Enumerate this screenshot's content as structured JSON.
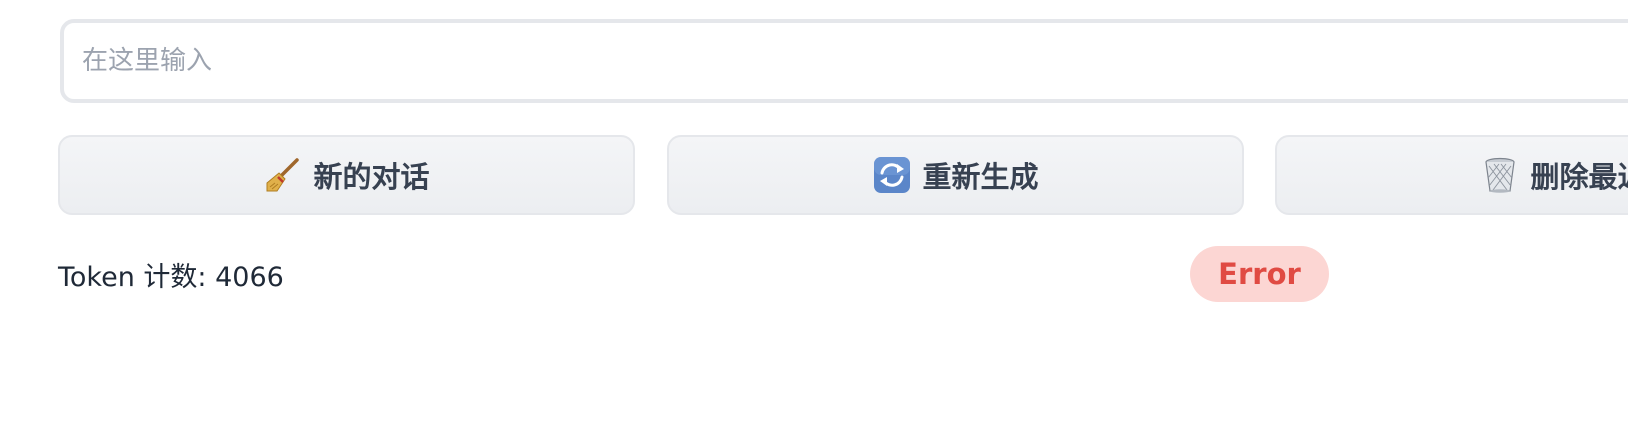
{
  "chat_input": {
    "value": "",
    "placeholder": "在这里输入"
  },
  "buttons": {
    "new_chat": {
      "icon": "broom-icon",
      "label": "新的对话"
    },
    "regenerate": {
      "icon": "refresh-arrows-icon",
      "label": "重新生成"
    },
    "delete_last": {
      "icon": "trash-bin-icon",
      "label": "删除最近"
    }
  },
  "status": {
    "token_count_label": "Token 计数: 4066",
    "error_badge": "Error"
  },
  "colors": {
    "error_text": "#e04b43",
    "error_bg": "#fcd6d3",
    "button_bg": "#eef0f3",
    "border": "#e5e7eb"
  }
}
